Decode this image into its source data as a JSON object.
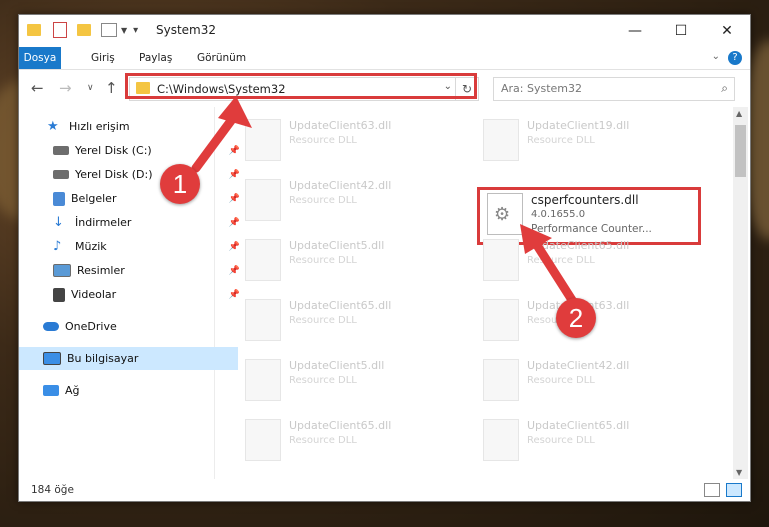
{
  "window": {
    "title": "System32",
    "controls": {
      "minimize": "—",
      "maximize": "☐",
      "close": "✕"
    }
  },
  "ribbon": {
    "tabs": [
      "Dosya",
      "Giriş",
      "Paylaş",
      "Görünüm"
    ],
    "active_tab": "Dosya",
    "help": "?"
  },
  "address": {
    "path": "C:\\Windows\\System32",
    "search_placeholder": "Ara: System32"
  },
  "nav": {
    "items": [
      {
        "label": "Hızlı erişim",
        "icon": "star-icon"
      },
      {
        "label": "Yerel Disk (C:)",
        "icon": "drive-icon"
      },
      {
        "label": "Yerel Disk (D:)",
        "icon": "drive-icon"
      },
      {
        "label": "Belgeler",
        "icon": "documents-icon"
      },
      {
        "label": "İndirmeler",
        "icon": "download-icon"
      },
      {
        "label": "Müzik",
        "icon": "music-icon"
      },
      {
        "label": "Resimler",
        "icon": "pictures-icon"
      },
      {
        "label": "Videolar",
        "icon": "videos-icon"
      },
      {
        "label": "OneDrive",
        "icon": "cloud-icon"
      },
      {
        "label": "Bu bilgisayar",
        "icon": "computer-icon"
      },
      {
        "label": "Ağ",
        "icon": "network-icon"
      }
    ],
    "selected": "Bu bilgisayar"
  },
  "files": {
    "left": [
      {
        "name": "UpdateClient63.dll",
        "type": "Resource DLL"
      },
      {
        "name": "UpdateClient42.dll",
        "type": "Resource DLL"
      },
      {
        "name": "UpdateClient5.dll",
        "type": "Resource DLL"
      },
      {
        "name": "UpdateClient65.dll",
        "type": "Resource DLL"
      },
      {
        "name": "UpdateClient5.dll",
        "type": "Resource DLL"
      },
      {
        "name": "UpdateClient65.dll",
        "type": "Resource DLL"
      }
    ],
    "right": [
      {
        "name": "UpdateClient19.dll",
        "type": "Resource DLL"
      },
      {
        "name": "UpdateClient65.dll",
        "type": "Resource DLL"
      },
      {
        "name": "UpdateClient63.dll",
        "type": "Resource DLL"
      },
      {
        "name": "UpdateClient42.dll",
        "type": "Resource DLL"
      },
      {
        "name": "UpdateClient65.dll",
        "type": "Resource DLL"
      }
    ],
    "highlighted": {
      "name": "csperfcounters.dll",
      "version": "4.0.1655.0",
      "description": "Performance Counter..."
    }
  },
  "status": {
    "count": "184 öğe"
  },
  "callouts": {
    "first": "1",
    "second": "2"
  },
  "colors": {
    "accent": "#1979ca",
    "highlight": "#d93b3b",
    "selection": "#cce8ff"
  }
}
